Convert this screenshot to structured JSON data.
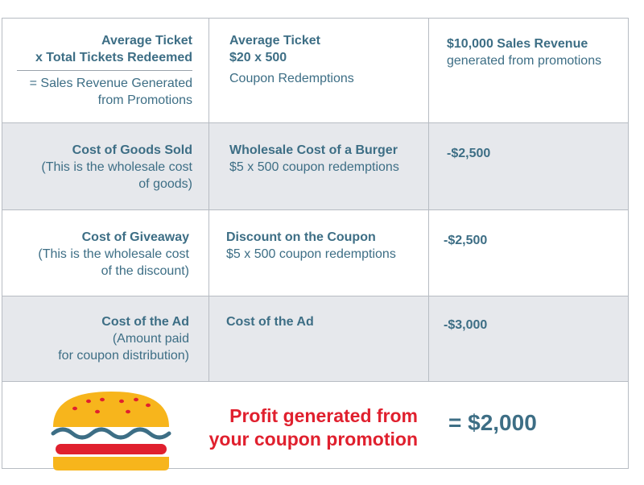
{
  "rows": [
    {
      "label_lines": [
        "Average Ticket",
        "x Total Tickets Redeemed"
      ],
      "label_sub_lines": [
        "= Sales Revenue Generated",
        "from Promotions"
      ],
      "example_bold_lines": [
        "Average Ticket",
        "$20 x 500"
      ],
      "example_sub": "Coupon Redemptions",
      "result_bold": "$10,000 Sales Revenue",
      "result_sub": "generated from promotions"
    },
    {
      "label": "Cost of Goods Sold",
      "label_sub_lines": [
        "(This is the wholesale cost",
        "of goods)"
      ],
      "example_bold": "Wholesale Cost of a Burger",
      "example_sub": "$5 x 500 coupon redemptions",
      "result": "-$2,500"
    },
    {
      "label": "Cost of Giveaway",
      "label_sub_lines": [
        "(This is the wholesale cost",
        "of the discount)"
      ],
      "example_bold": "Discount on the Coupon",
      "example_sub": "$5 x 500 coupon redemptions",
      "result": "-$2,500"
    },
    {
      "label": "Cost of the Ad",
      "label_sub_lines": [
        "(Amount paid",
        "for coupon distribution)"
      ],
      "example_bold": "Cost of the Ad",
      "result": "-$3,000"
    }
  ],
  "profit": {
    "text_lines": [
      "Profit generated from",
      "your coupon promotion"
    ],
    "value": "= $2,000"
  },
  "icon": "burger-icon",
  "colors": {
    "text": "#3d6e85",
    "profit_text": "#e0202e",
    "shade": "#e6e8ec",
    "border": "#b7bcc3"
  }
}
